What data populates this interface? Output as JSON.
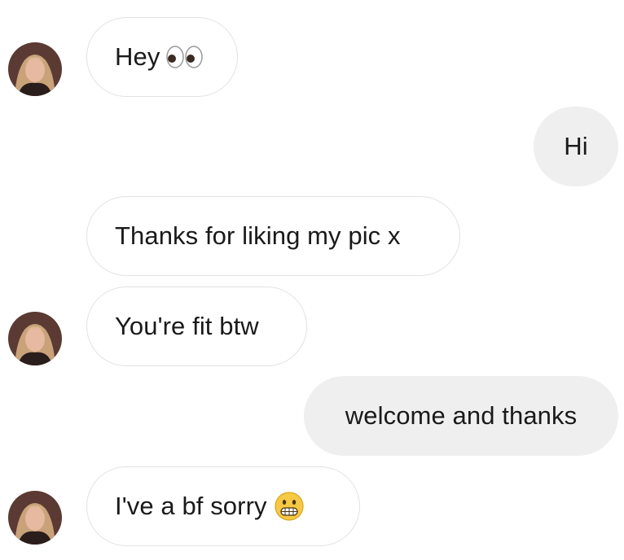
{
  "conversation": {
    "messages": [
      {
        "sender": "them",
        "text": "Hey",
        "emoji": "eyes-emoji"
      },
      {
        "sender": "me",
        "text": "Hi"
      },
      {
        "sender": "them",
        "text": "Thanks for liking my pic x"
      },
      {
        "sender": "them",
        "text": "You're fit btw"
      },
      {
        "sender": "me",
        "text": "welcome and thanks"
      },
      {
        "sender": "them",
        "text": "I've a bf sorry",
        "emoji": "grimacing-face-emoji"
      }
    ]
  },
  "colors": {
    "incoming_bubble_bg": "#ffffff",
    "incoming_bubble_border": "#e2e2e2",
    "outgoing_bubble_bg": "#efefef",
    "text": "#1a1a1a"
  }
}
